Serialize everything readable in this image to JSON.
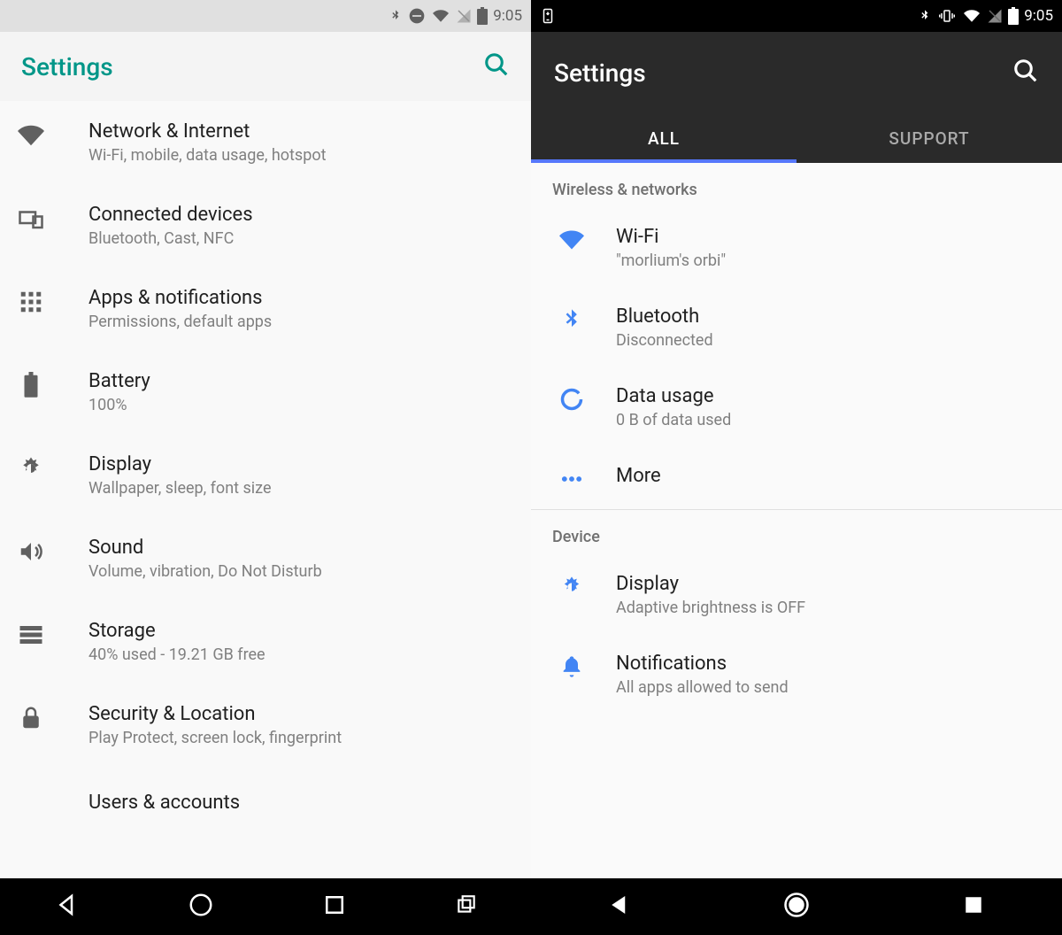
{
  "left": {
    "status_time": "9:05",
    "title": "Settings",
    "items": [
      {
        "icon": "wifi",
        "label": "Network & Internet",
        "sublabel": "Wi-Fi, mobile, data usage, hotspot"
      },
      {
        "icon": "devices",
        "label": "Connected devices",
        "sublabel": "Bluetooth, Cast, NFC"
      },
      {
        "icon": "apps",
        "label": "Apps & notifications",
        "sublabel": "Permissions, default apps"
      },
      {
        "icon": "battery",
        "label": "Battery",
        "sublabel": "100%"
      },
      {
        "icon": "display",
        "label": "Display",
        "sublabel": "Wallpaper, sleep, font size"
      },
      {
        "icon": "sound",
        "label": "Sound",
        "sublabel": "Volume, vibration, Do Not Disturb"
      },
      {
        "icon": "storage",
        "label": "Storage",
        "sublabel": "40% used - 19.21 GB free"
      },
      {
        "icon": "lock",
        "label": "Security & Location",
        "sublabel": "Play Protect, screen lock, fingerprint"
      },
      {
        "icon": "users",
        "label": "Users & accounts",
        "sublabel": ""
      }
    ]
  },
  "right": {
    "status_time": "9:05",
    "title": "Settings",
    "tabs": [
      {
        "label": "ALL",
        "active": true
      },
      {
        "label": "SUPPORT",
        "active": false
      }
    ],
    "sections": [
      {
        "label": "Wireless & networks",
        "items": [
          {
            "icon": "wifi-blue",
            "label": "Wi-Fi",
            "sublabel": "\"morlium's orbi\""
          },
          {
            "icon": "bluetooth-blue",
            "label": "Bluetooth",
            "sublabel": "Disconnected"
          },
          {
            "icon": "data-blue",
            "label": "Data usage",
            "sublabel": "0 B of data used"
          },
          {
            "icon": "more-blue",
            "label": "More",
            "sublabel": ""
          }
        ]
      },
      {
        "label": "Device",
        "items": [
          {
            "icon": "display-blue",
            "label": "Display",
            "sublabel": "Adaptive brightness is OFF"
          },
          {
            "icon": "bell-blue",
            "label": "Notifications",
            "sublabel": "All apps allowed to send"
          }
        ]
      }
    ]
  }
}
